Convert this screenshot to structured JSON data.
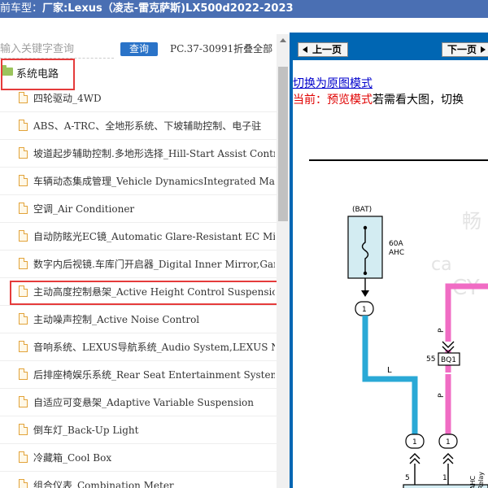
{
  "header": {
    "prefix": "前车型：",
    "vehicle": "厂家:Lexus（凌志-雷克萨斯)LX500d2022-2023"
  },
  "search": {
    "placeholder": "输入关键字查询",
    "button_label": "查询",
    "pc_info": "PC.37-30991折叠全部"
  },
  "tree": {
    "root_label": "系统电路",
    "items": [
      "四轮驱动_4WD",
      "ABS、A-TRC、全地形系统、下坡辅助控制、电子驻",
      "坡道起步辅助控制.多地形选择_Hill-Start Assist Contr",
      "车辆动态集成管理_Vehicle DynamicsIntegrated Mana",
      "空调_Air Conditioner",
      "自动防眩光EC镜_Automatic Glare-Resistant EC Mirro",
      "数字内后视镜.车库门开启器_Digital Inner Mirror,Gara",
      "主动高度控制悬架_Active Height Control Suspension",
      "主动噪声控制_Active Noise Control",
      "音响系统、LEXUS导航系统_Audio System,LEXUS Na",
      "后排座椅娱乐系统_Rear Seat Entertainment System",
      "自适应可变悬架_Adaptive Variable Suspension",
      "倒车灯_Back-Up Light",
      "冷藏箱_Cool Box",
      "组合仪表_Combination Meter"
    ],
    "selected_index": 7
  },
  "viewer": {
    "prev_label": "上一页",
    "next_label": "下一页",
    "switch_link": "切换为原图模式",
    "mode_prefix": "当前：",
    "mode_name": "预览模式",
    "mode_tail": "若需看大图，切换"
  },
  "diagram": {
    "bat_label": "(BAT)",
    "fuse_amp": "60A",
    "fuse_name": "AHC",
    "wire_l": "L",
    "wire_p": "P",
    "connector_num": "55",
    "connector_name": "BQ1",
    "pin_one": "1",
    "pin_five": "5",
    "relay_label_1": "AHC",
    "relay_label_2": "Relay",
    "watermark_1": "畅",
    "watermark_2": "ca",
    "watermark_3": "CY"
  },
  "colors": {
    "title_bar": "#4a6fb3",
    "nav_bar": "#0066b3",
    "highlight": "#e53b3b",
    "wire_blue": "#2aa9d6",
    "wire_pink": "#f06cc4"
  }
}
